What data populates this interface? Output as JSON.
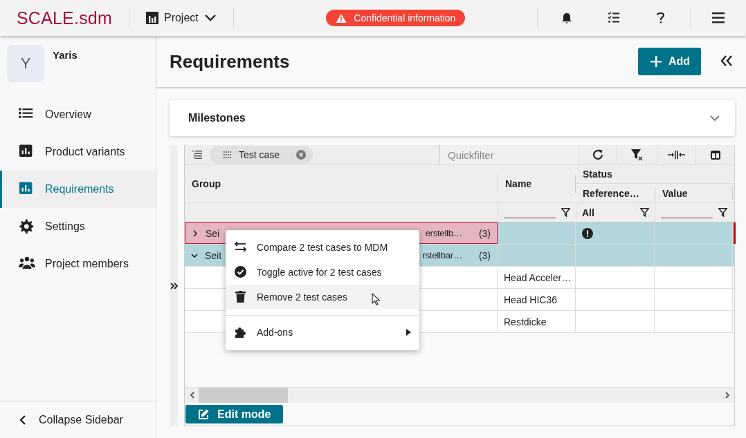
{
  "header": {
    "logo": "SCALE.sdm",
    "project_menu": "Project",
    "notice": "Confidential information"
  },
  "sidebar": {
    "project": {
      "initial": "Y",
      "name": "Yaris"
    },
    "items": [
      {
        "label": "Overview",
        "selected": false
      },
      {
        "label": "Product variants",
        "selected": false
      },
      {
        "label": "Requirements",
        "selected": true
      },
      {
        "label": "Settings",
        "selected": false
      },
      {
        "label": "Project members",
        "selected": false
      }
    ],
    "collapse": "Collapse Sidebar"
  },
  "page": {
    "title": "Requirements",
    "add_button": "Add"
  },
  "milestones": {
    "title": "Milestones",
    "expanded": false
  },
  "grid": {
    "group_chip": "Test case",
    "quickfilter_placeholder": "Quickfilter",
    "columns": {
      "group": "Group",
      "name": "Name",
      "status": "Status",
      "reference": "Reference…",
      "value": "Value"
    },
    "filters": {
      "reference": "All"
    },
    "rows": [
      {
        "kind": "group",
        "expanded": false,
        "selected": true,
        "focused": true,
        "text_start": "Sei",
        "text_end": "erstellb…",
        "count": "(3)",
        "reference_warning": true
      },
      {
        "kind": "group",
        "expanded": true,
        "selected": true,
        "focused": false,
        "text_start": "Seit",
        "text_end": "rstellbar…",
        "count": "(3)"
      },
      {
        "kind": "leaf",
        "name": "Head Acceler…"
      },
      {
        "kind": "leaf",
        "name": "Head HIC36"
      },
      {
        "kind": "leaf",
        "name": "Restdicke"
      }
    ],
    "edit_button": "Edit mode"
  },
  "context_menu": {
    "items": [
      {
        "kind": "action",
        "label": "Compare 2 test cases to MDM",
        "selected": false
      },
      {
        "kind": "action",
        "label": "Toggle active for 2 test cases",
        "selected": false
      },
      {
        "kind": "action",
        "label": "Remove 2 test cases",
        "selected": true
      },
      {
        "kind": "submenu",
        "label": "Add-ons",
        "selected": false
      }
    ]
  }
}
